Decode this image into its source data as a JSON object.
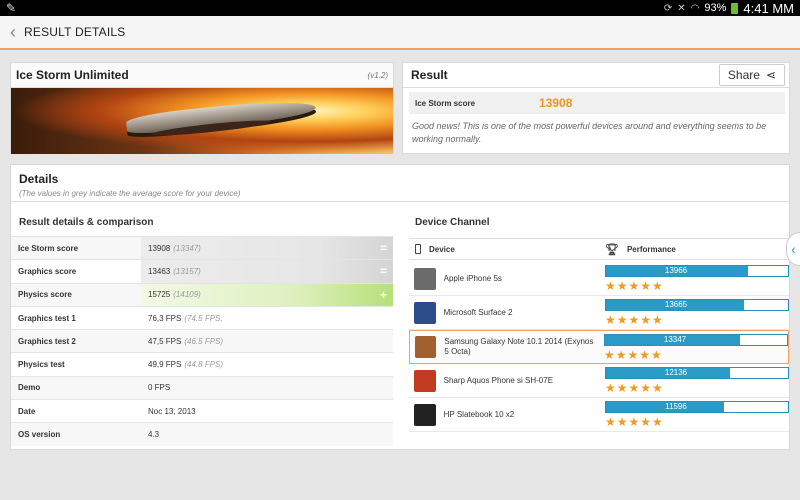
{
  "status_bar": {
    "battery": "93%",
    "time": "4:41 MM"
  },
  "action_bar": {
    "title": "RESULT DETAILS"
  },
  "test": {
    "name": "Ice Storm Unlimited",
    "version": "(v1.2)"
  },
  "result": {
    "title": "Result",
    "share_label": "Share",
    "score_label": "Ice Storm score",
    "score": "13908",
    "message": "Good news! This is one of the most powerful devices around and everything seems to be working normally."
  },
  "details": {
    "title": "Details",
    "subtitle": "(The values in grey indicate the average score for your device)",
    "comparison_header": "Result details & comparison",
    "rows": [
      {
        "label": "Ice Storm score",
        "value": "13908",
        "avg": "(13347)",
        "mark": "="
      },
      {
        "label": "Graphics score",
        "value": "13463",
        "avg": "(13157)",
        "mark": "="
      },
      {
        "label": "Physics score",
        "value": "15725",
        "avg": "(14109)",
        "mark": "+"
      },
      {
        "label": "Graphics test 1",
        "value": "76,3 FPS",
        "avg": "(74.5 FPS,",
        "mark": ""
      },
      {
        "label": "Graphics test 2",
        "value": "47,5 FPS",
        "avg": "(46.5 FPS)",
        "mark": ""
      },
      {
        "label": "Physics test",
        "value": "49,9 FPS",
        "avg": "(44.8 FPS)",
        "mark": ""
      },
      {
        "label": "Demo",
        "value": "0 FPS",
        "avg": "",
        "mark": ""
      },
      {
        "label": "Date",
        "value": "Noc 13, 2013",
        "avg": "",
        "mark": ""
      },
      {
        "label": "OS version",
        "value": "4.3",
        "avg": "",
        "mark": ""
      }
    ]
  },
  "device_channel": {
    "header": "Device Channel",
    "col_device": "Device",
    "col_performance": "Performance",
    "devices": [
      {
        "name": "Apple iPhone 5s",
        "score": "13966",
        "fill": 0.78,
        "stars": "★★★★★",
        "thumb": "#6b6b6b"
      },
      {
        "name": "Microsoft Surface 2",
        "score": "13665",
        "fill": 0.76,
        "stars": "★★★★★",
        "thumb": "#2c4c8c"
      },
      {
        "name": "Samsung Galaxy Note 10.1 2014 (Exynos 5 Octa)",
        "score": "13347",
        "fill": 0.74,
        "stars": "★★★★★",
        "thumb": "#a06030"
      },
      {
        "name": "Sharp Aquos Phone si SH-07E",
        "score": "12136",
        "fill": 0.68,
        "stars": "★★★★★",
        "thumb": "#c23a20"
      },
      {
        "name": "HP Slatebook 10 x2",
        "score": "11596",
        "fill": 0.65,
        "stars": "★★★★★",
        "thumb": "#222222"
      }
    ]
  },
  "icons": {
    "back": "chevron-left-icon",
    "share": "share-icon",
    "device": "phone-icon",
    "performance": "trophy-icon",
    "side_tab": "chevron-left-icon"
  },
  "colors": {
    "accent_orange": "#f29420",
    "bar_blue": "#2a9ac7",
    "star": "#f29a1c"
  }
}
